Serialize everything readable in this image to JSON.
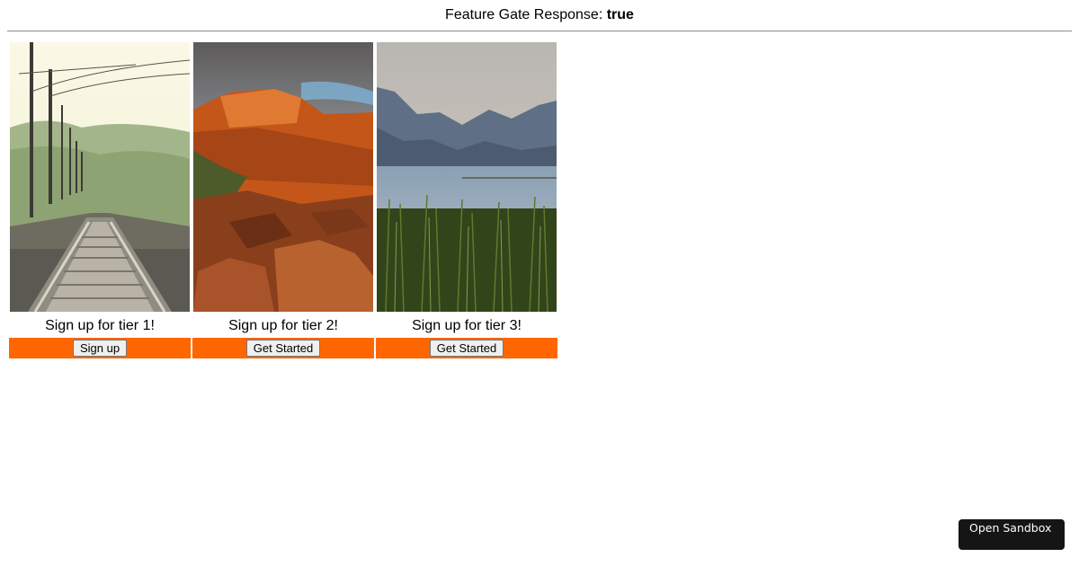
{
  "header": {
    "label": "Feature Gate Response:",
    "value": "true"
  },
  "cards": [
    {
      "photo": "railway-tracks-photo",
      "title": "Sign up for tier 1!",
      "button": "Sign up"
    },
    {
      "photo": "red-rocks-landscape-photo",
      "title": "Sign up for tier 2!",
      "button": "Get Started"
    },
    {
      "photo": "lake-reeds-mountains-photo",
      "title": "Sign up for tier 3!",
      "button": "Get Started"
    }
  ],
  "colors": {
    "accent_bar": "#ff6600",
    "sandbox_bg": "#151515"
  },
  "sandbox_button": {
    "label": "Open Sandbox"
  }
}
